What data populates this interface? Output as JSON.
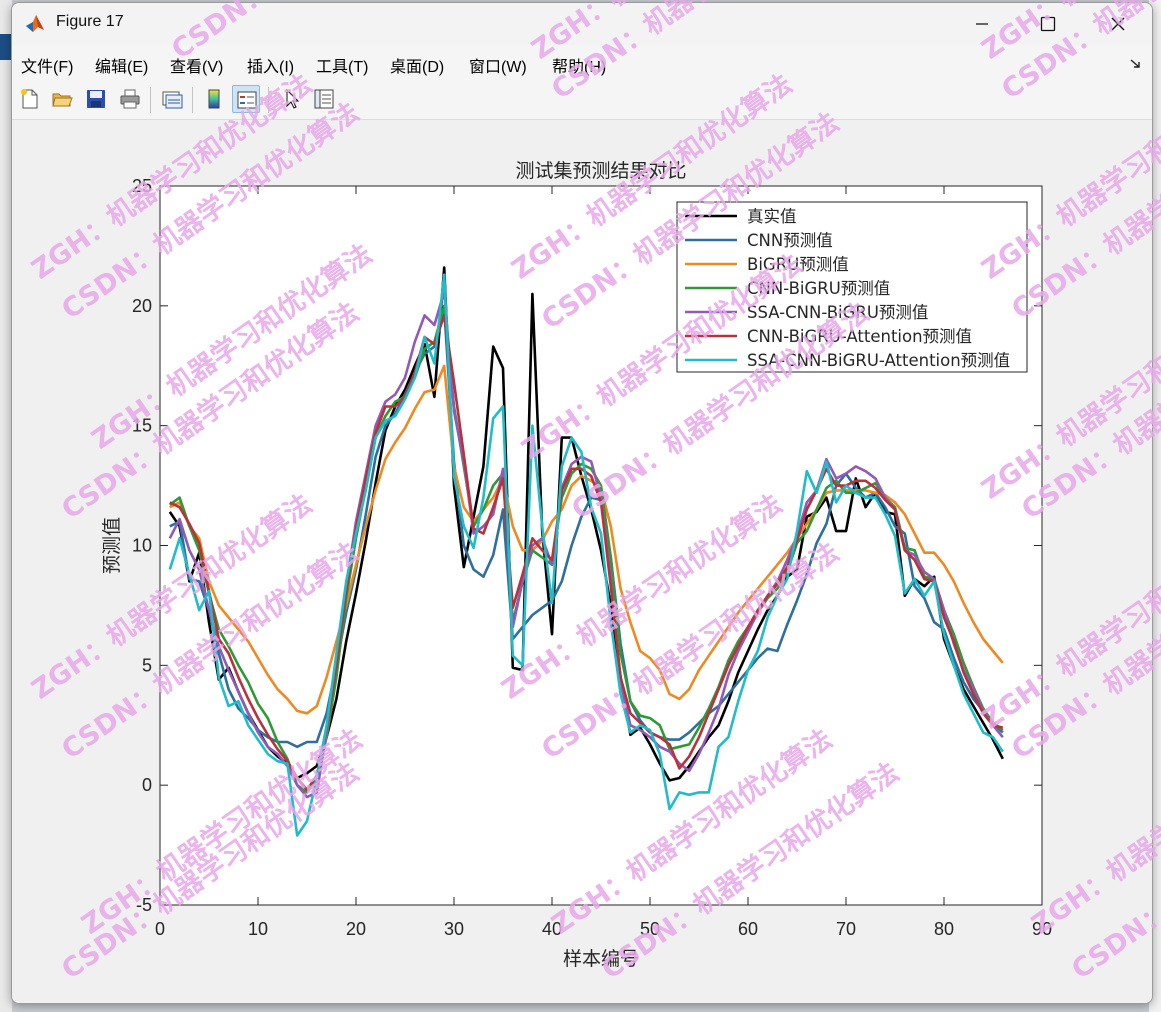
{
  "window": {
    "title": "Figure 17",
    "menu": [
      "文件(F)",
      "编辑(E)",
      "查看(V)",
      "插入(I)",
      "工具(T)",
      "桌面(D)",
      "窗口(W)",
      "帮助(H)"
    ],
    "toolbar_icons": [
      "new-figure-icon",
      "open-file-icon",
      "save-icon",
      "print-icon",
      "link-plot-icon",
      "colorbar-icon",
      "legend-icon",
      "pointer-icon",
      "property-inspector-icon"
    ]
  },
  "chart_data": {
    "type": "line",
    "title": "测试集预测结果对比",
    "xlabel": "样本编号",
    "ylabel": "预测值",
    "xlim": [
      0,
      90
    ],
    "ylim": [
      -5,
      25
    ],
    "xticks": [
      0,
      10,
      20,
      30,
      40,
      50,
      60,
      70,
      80,
      90
    ],
    "yticks": [
      -5,
      0,
      5,
      10,
      15,
      20,
      25
    ],
    "grid": false,
    "legend_position": "top-right",
    "x": [
      1,
      2,
      3,
      4,
      5,
      6,
      7,
      8,
      9,
      10,
      11,
      12,
      13,
      14,
      15,
      16,
      17,
      18,
      19,
      20,
      21,
      22,
      23,
      24,
      25,
      26,
      27,
      28,
      29,
      30,
      31,
      32,
      33,
      34,
      35,
      36,
      37,
      38,
      39,
      40,
      41,
      42,
      43,
      44,
      45,
      46,
      47,
      48,
      49,
      50,
      51,
      52,
      53,
      54,
      55,
      56,
      57,
      58,
      59,
      60,
      61,
      62,
      63,
      64,
      65,
      66,
      67,
      68,
      69,
      70,
      71,
      72,
      73,
      74,
      75,
      76,
      77,
      78,
      79,
      80,
      81,
      82,
      83,
      84,
      85,
      86
    ],
    "series": [
      {
        "name": "真实值",
        "color": "#000000",
        "values": [
          11.4,
          10.8,
          8.5,
          9.7,
          6.8,
          4.4,
          4.9,
          3.9,
          3.0,
          2.3,
          1.6,
          1.2,
          0.9,
          0.3,
          0.5,
          0.8,
          2.0,
          3.6,
          6.0,
          8.0,
          10.2,
          12.6,
          14.8,
          15.8,
          16.5,
          17.5,
          18.4,
          16.2,
          21.6,
          12.5,
          9.1,
          11.2,
          13.3,
          18.3,
          17.4,
          4.9,
          4.8,
          20.5,
          10.6,
          6.3,
          14.5,
          14.5,
          12.9,
          11.5,
          9.8,
          7.5,
          4.5,
          2.1,
          2.4,
          1.7,
          0.9,
          0.2,
          0.3,
          0.8,
          1.4,
          2.0,
          2.5,
          3.5,
          4.7,
          5.6,
          6.5,
          7.3,
          7.9,
          8.7,
          9.0,
          11.2,
          11.4,
          12.0,
          10.6,
          10.6,
          12.8,
          11.6,
          12.2,
          11.4,
          11.3,
          7.9,
          8.6,
          8.3,
          8.7,
          6.1,
          5.0,
          4.0,
          3.3,
          2.6,
          1.9,
          1.1
        ]
      },
      {
        "name": "CNN预测值",
        "color": "#2e6f9e",
        "values": [
          10.8,
          11.0,
          8.6,
          8.5,
          7.3,
          5.5,
          4.0,
          3.2,
          2.8,
          2.3,
          2.0,
          1.8,
          1.8,
          1.6,
          1.8,
          1.8,
          3.0,
          5.0,
          7.2,
          9.0,
          11.3,
          13.7,
          15.0,
          15.5,
          16.3,
          17.2,
          18.0,
          18.3,
          19.9,
          13.5,
          10.0,
          9.0,
          8.7,
          9.6,
          11.5,
          6.1,
          6.6,
          7.1,
          7.4,
          7.7,
          8.5,
          10.0,
          11.2,
          12.0,
          11.9,
          9.5,
          5.9,
          3.5,
          2.7,
          2.2,
          2.0,
          1.9,
          1.9,
          2.2,
          2.6,
          3.0,
          3.3,
          3.8,
          4.3,
          4.8,
          5.3,
          5.7,
          5.6,
          6.7,
          7.7,
          8.8,
          10.1,
          10.9,
          12.5,
          13.0,
          12.4,
          12.0,
          12.2,
          11.6,
          10.8,
          10.5,
          8.3,
          7.8,
          6.8,
          6.5,
          5.3,
          4.3,
          3.6,
          3.1,
          2.6,
          2.2
        ]
      },
      {
        "name": "BiGRU预测值",
        "color": "#ee8a22",
        "values": [
          11.6,
          11.8,
          10.8,
          10.3,
          8.5,
          7.5,
          7.0,
          6.5,
          6.0,
          5.3,
          4.6,
          4.0,
          3.6,
          3.1,
          3.0,
          3.3,
          4.5,
          6.0,
          7.5,
          9.2,
          10.8,
          12.3,
          13.6,
          14.3,
          14.9,
          15.7,
          16.4,
          16.5,
          17.5,
          13.3,
          11.6,
          11.0,
          11.5,
          12.0,
          12.8,
          10.8,
          9.8,
          9.8,
          10.2,
          11.0,
          11.5,
          12.5,
          12.9,
          12.7,
          12.4,
          10.8,
          8.2,
          6.8,
          5.6,
          5.3,
          4.8,
          3.8,
          3.6,
          4.0,
          4.8,
          5.4,
          6.0,
          6.6,
          7.2,
          7.7,
          8.2,
          8.7,
          9.2,
          9.7,
          10.3,
          10.9,
          11.5,
          12.2,
          12.3,
          12.3,
          12.3,
          12.3,
          12.2,
          12.1,
          11.8,
          11.3,
          10.5,
          9.7,
          9.7,
          9.2,
          8.5,
          7.6,
          6.8,
          6.1,
          5.6,
          5.1
        ]
      },
      {
        "name": "CNN-BiGRU预测值",
        "color": "#2e9a35",
        "values": [
          11.7,
          12.0,
          10.8,
          9.8,
          8.0,
          6.5,
          5.8,
          5.0,
          4.3,
          3.4,
          2.8,
          1.8,
          1.1,
          0.0,
          -0.3,
          0.3,
          2.0,
          4.5,
          7.8,
          10.3,
          12.4,
          14.5,
          15.4,
          16.0,
          16.2,
          17.0,
          18.2,
          18.5,
          20.0,
          15.8,
          13.3,
          10.8,
          11.5,
          12.5,
          13.0,
          6.8,
          8.5,
          9.8,
          9.5,
          9.2,
          12.0,
          13.0,
          13.4,
          13.2,
          12.5,
          9.5,
          5.5,
          3.5,
          2.9,
          2.8,
          2.5,
          1.5,
          1.6,
          1.7,
          2.4,
          3.2,
          4.1,
          5.2,
          6.0,
          6.6,
          7.2,
          7.8,
          8.2,
          8.9,
          10.1,
          10.6,
          11.5,
          12.4,
          12.7,
          12.2,
          12.2,
          12.4,
          12.6,
          12.0,
          11.6,
          9.9,
          9.8,
          8.7,
          8.6,
          7.3,
          6.3,
          5.1,
          4.1,
          3.2,
          2.6,
          2.3
        ]
      },
      {
        "name": "SSA-CNN-BiGRU预测值",
        "color": "#9358b8",
        "values": [
          10.3,
          11.1,
          9.8,
          9.0,
          7.3,
          5.8,
          4.8,
          3.9,
          3.0,
          2.2,
          1.6,
          1.3,
          0.8,
          0.0,
          -0.5,
          -0.3,
          2.2,
          5.2,
          8.3,
          11.0,
          13.0,
          15.0,
          16.0,
          16.3,
          17.0,
          18.5,
          19.6,
          19.2,
          20.6,
          15.6,
          13.5,
          10.5,
          10.8,
          11.3,
          13.2,
          6.6,
          8.5,
          10.0,
          10.3,
          9.2,
          12.4,
          13.4,
          13.7,
          13.5,
          12.0,
          8.6,
          4.3,
          2.5,
          2.3,
          2.0,
          1.6,
          1.4,
          0.9,
          0.6,
          1.3,
          2.2,
          3.2,
          4.6,
          5.6,
          6.4,
          7.2,
          7.9,
          8.5,
          9.4,
          10.4,
          11.8,
          12.3,
          13.6,
          12.8,
          13.0,
          13.3,
          13.1,
          12.8,
          12.0,
          11.5,
          9.8,
          9.6,
          8.9,
          8.6,
          7.3,
          5.9,
          4.8,
          4.0,
          3.1,
          2.5,
          2.0
        ]
      },
      {
        "name": "CNN-BiGRU-Attention预测值",
        "color": "#b8313b",
        "values": [
          11.8,
          11.6,
          10.9,
          10.1,
          8.1,
          6.1,
          5.5,
          4.5,
          3.6,
          2.8,
          2.1,
          1.5,
          1.0,
          0.3,
          -0.2,
          0.4,
          2.4,
          5.0,
          8.1,
          10.7,
          12.8,
          14.7,
          15.8,
          15.8,
          16.2,
          17.2,
          18.7,
          18.4,
          19.6,
          16.8,
          13.8,
          10.7,
          10.5,
          11.6,
          12.8,
          7.4,
          8.8,
          10.3,
          9.8,
          9.4,
          12.3,
          13.2,
          13.2,
          12.9,
          11.8,
          8.3,
          4.5,
          3.0,
          2.6,
          2.2,
          2.0,
          1.7,
          0.7,
          1.2,
          2.0,
          3.0,
          4.0,
          5.0,
          5.8,
          6.6,
          7.3,
          7.9,
          8.4,
          9.1,
          10.2,
          11.5,
          12.3,
          13.2,
          12.5,
          12.5,
          12.7,
          12.7,
          12.4,
          11.9,
          11.5,
          9.8,
          9.4,
          8.6,
          8.5,
          7.0,
          6.0,
          4.7,
          3.8,
          3.0,
          2.5,
          2.4
        ]
      },
      {
        "name": "SSA-CNN-BiGRU-Attention预测值",
        "color": "#1fbcc9",
        "values": [
          9.0,
          10.3,
          8.8,
          7.3,
          8.1,
          4.5,
          3.3,
          3.5,
          2.5,
          1.9,
          1.3,
          1.0,
          0.9,
          -2.1,
          -1.5,
          0.3,
          2.5,
          5.5,
          8.5,
          10.5,
          12.3,
          14.5,
          15.2,
          15.4,
          16.1,
          17.0,
          18.7,
          17.6,
          21.3,
          12.9,
          10.8,
          9.9,
          12.0,
          15.3,
          15.8,
          5.4,
          5.0,
          15.0,
          10.8,
          7.6,
          13.3,
          14.5,
          13.9,
          11.6,
          10.5,
          6.8,
          3.8,
          2.2,
          2.5,
          2.3,
          1.3,
          -1.0,
          -0.3,
          -0.4,
          -0.3,
          -0.3,
          1.6,
          2.0,
          3.5,
          4.8,
          5.6,
          7.0,
          7.9,
          8.6,
          10.6,
          13.1,
          12.2,
          13.5,
          11.8,
          12.5,
          12.2,
          12.0,
          12.0,
          11.3,
          10.4,
          8.0,
          8.6,
          7.9,
          8.5,
          6.3,
          5.0,
          3.8,
          3.0,
          2.2,
          2.0,
          1.4
        ]
      }
    ]
  },
  "watermarks": [
    "ZGH：机器学习和优化算法",
    "CSDN：机器学习和优化算法"
  ]
}
